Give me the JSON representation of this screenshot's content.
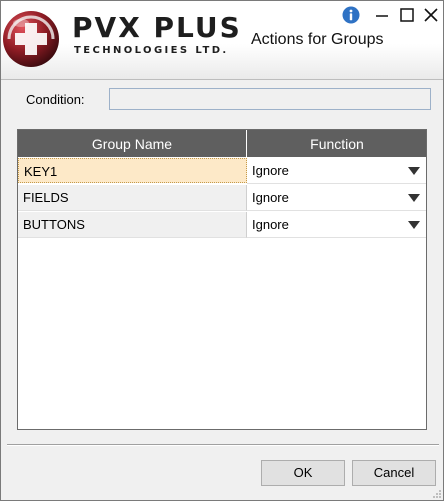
{
  "header": {
    "logo_title": "PVX PLUS",
    "logo_subtitle": "TECHNOLOGIES LTD.",
    "window_title": "Actions for Groups",
    "icons": [
      "info-icon",
      "minimize-icon",
      "maximize-icon",
      "close-icon"
    ],
    "info_color": "#2f72c4"
  },
  "condition": {
    "label": "Condition:",
    "value": ""
  },
  "grid": {
    "columns": [
      "Group Name",
      "Function"
    ],
    "header_color": "#5f5f5f",
    "rows": [
      {
        "name": "KEY1",
        "function": "Ignore",
        "selected": true
      },
      {
        "name": "FIELDS",
        "function": "Ignore",
        "selected": false
      },
      {
        "name": "BUTTONS",
        "function": "Ignore",
        "selected": false
      }
    ]
  },
  "buttons": {
    "ok": "OK",
    "cancel": "Cancel"
  }
}
